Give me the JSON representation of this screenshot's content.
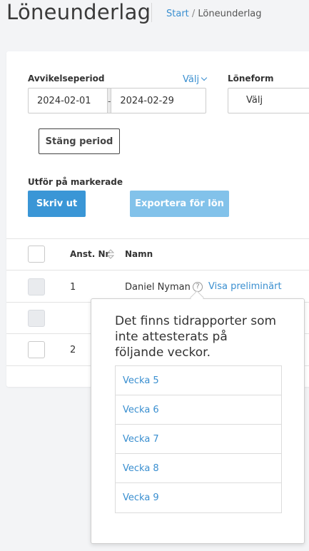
{
  "header": {
    "title": "Löneunderlag",
    "breadcrumb_start": "Start",
    "breadcrumb_sep": " / ",
    "breadcrumb_current": "Löneunderlag"
  },
  "filters": {
    "period_label": "Avvikelseperiod",
    "valj_link": "Välj",
    "date_from": "2024-02-01",
    "date_separator": "-",
    "date_to": "2024-02-29",
    "loneform_label": "Löneform",
    "loneform_value": "Välj"
  },
  "actions": {
    "close_period": "Stäng period",
    "bulk_label": "Utför på markerade",
    "print": "Skriv ut",
    "export": "Exportera för lön"
  },
  "table": {
    "columns": [
      "Anst. Nr",
      "Namn"
    ],
    "rows": [
      {
        "anst_nr": "1",
        "namn": "Daniel Nyman",
        "link": "Visa preliminärt"
      },
      {
        "anst_nr": "",
        "namn": "",
        "link": ""
      },
      {
        "anst_nr": "2",
        "namn": "",
        "link": ""
      }
    ]
  },
  "popover": {
    "message": "Det finns tidrapporter som inte attesterats på följande veckor.",
    "weeks": [
      "Vecka 5",
      "Vecka 6",
      "Vecka 7",
      "Vecka 8",
      "Vecka 9"
    ]
  },
  "colors": {
    "accent": "#3a96d6",
    "link": "#3a8fd0",
    "disabled": "#82c2ea",
    "background": "#f3f4f6"
  },
  "icons": {
    "help": "question-circle-icon",
    "sort": "sort-icon",
    "chevron": "chevron-down-icon"
  }
}
